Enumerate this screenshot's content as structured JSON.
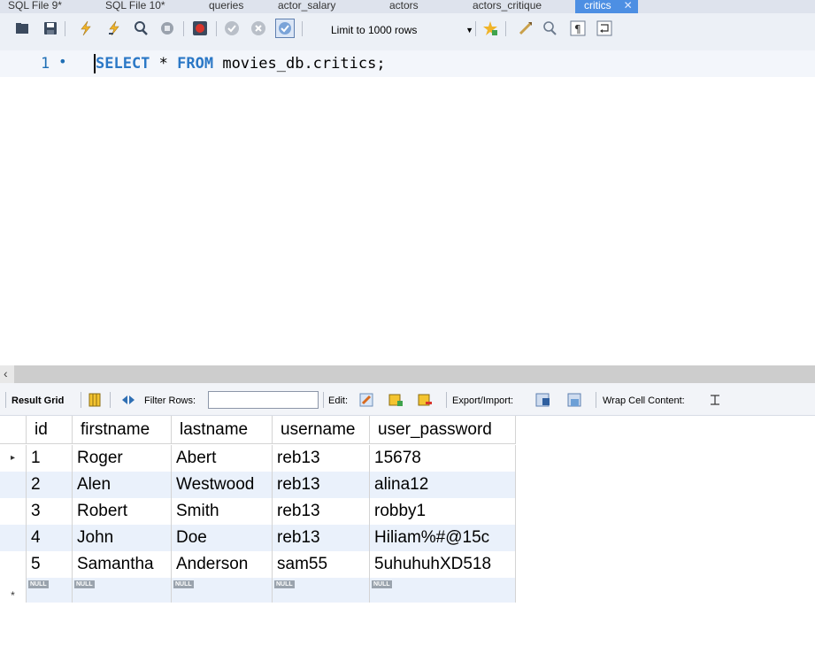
{
  "tabs": [
    {
      "label": "SQL File 9*",
      "active": false
    },
    {
      "label": "SQL File 10*",
      "active": false
    },
    {
      "label": "queries",
      "active": false
    },
    {
      "label": "actor_salary",
      "active": false
    },
    {
      "label": "actors",
      "active": false
    },
    {
      "label": "actors_critique",
      "active": false
    },
    {
      "label": "critics",
      "active": true
    }
  ],
  "tab_close_glyph": "✕",
  "toolbar": {
    "icons": [
      "open-folder-icon",
      "save-icon",
      "execute-icon",
      "execute-current-icon",
      "explain-icon",
      "stop-icon",
      "toggle-error-icon",
      "commit-icon",
      "rollback-icon",
      "autocommit-icon"
    ],
    "limit_label": "Limit to 1000 rows",
    "right_icons": [
      "add-snippet-icon",
      "beautify-icon",
      "find-icon",
      "invisible-chars-icon",
      "wrap-lines-icon"
    ]
  },
  "editor": {
    "line_number": "1",
    "line_marker": "•",
    "keyword_select": "SELECT",
    "star": " * ",
    "keyword_from": "FROM",
    "object": " movies_db.critics;"
  },
  "result_toolbar": {
    "result_grid_label": "Result Grid",
    "filter_label": "Filter Rows:",
    "filter_value": "",
    "edit_label": "Edit:",
    "export_label": "Export/Import:",
    "wrap_label": "Wrap Cell Content:"
  },
  "grid": {
    "columns": [
      "id",
      "firstname",
      "lastname",
      "username",
      "user_password"
    ],
    "rows": [
      [
        "1",
        "Roger",
        "Abert",
        "reb13",
        "15678"
      ],
      [
        "2",
        "Alen",
        "Westwood",
        "reb13",
        "alina12"
      ],
      [
        "3",
        "Robert",
        "Smith",
        "reb13",
        "robby1"
      ],
      [
        "4",
        "John",
        "Doe",
        "reb13",
        "Hiliam%#@15c"
      ],
      [
        "5",
        "Samantha",
        "Anderson",
        "sam55",
        "5uhuhuhXD518"
      ]
    ],
    "null_label": "NULL",
    "new_row_marker": "*",
    "selected_row_marker": "▸"
  },
  "colors": {
    "active_tab": "#4d8fe3",
    "keyword": "#2b78c6",
    "alt_row": "#eaf1fb"
  }
}
